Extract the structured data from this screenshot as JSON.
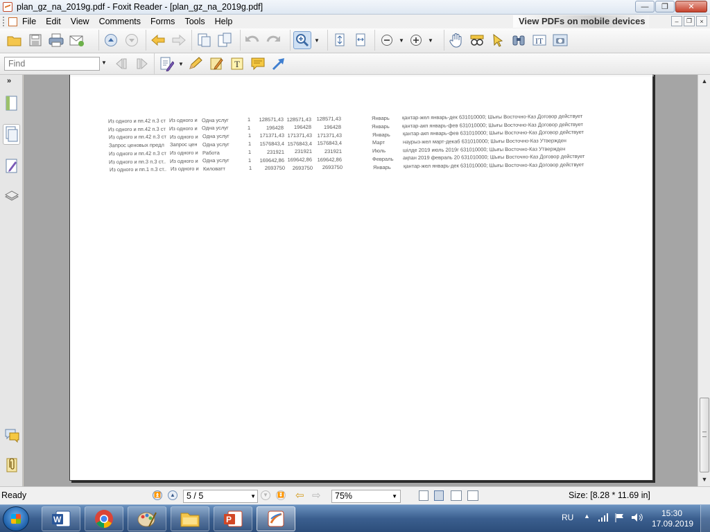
{
  "window": {
    "title": "plan_gz_na_2019g.pdf - Foxit Reader - [plan_gz_na_2019g.pdf]",
    "minimize_label": "—",
    "maximize_label": "❐",
    "close_label": "✕"
  },
  "menu": {
    "items": [
      "File",
      "Edit",
      "View",
      "Comments",
      "Forms",
      "Tools",
      "Help"
    ],
    "banner": "View PDFs on mobile devices",
    "mdi_min": "–",
    "mdi_restore": "❐",
    "mdi_close": "×"
  },
  "find": {
    "placeholder": "Find"
  },
  "document": {
    "rows": [
      {
        "a": "Из одного и пп.42 п.3 ст",
        "b": "Из одного и",
        "c": "Одна услуг",
        "q": "1",
        "v1": "128571,43",
        "v2": "128571,43",
        "v3": "128571,43",
        "month": "Январь",
        "text": "қантар-жел январь-дек 631010000; Шығы Восточно-Каз Договор действует"
      },
      {
        "a": "Из одного и пп.42 п.3 ст",
        "b": "Из одного и",
        "c": "Одна услуг",
        "q": "1",
        "v1": "196428",
        "v2": "196428",
        "v3": "196428",
        "month": "Январь",
        "text": "қантар-акп январь-фев 631010000; Шығы Восточно-Каз Договор действует"
      },
      {
        "a": "Из одного и пп.42 п.3 ст",
        "b": "Из одного и",
        "c": "Одна услуг",
        "q": "1",
        "v1": "171371,43",
        "v2": "171371,43",
        "v3": "171371,43",
        "month": "Январь",
        "text": "қантар-акп январь-фев 631010000; Шығы Восточно-Каз Договор действует"
      },
      {
        "a": "Запрос ценовых предл",
        "b": "Запрос цен",
        "c": "Одна услуг",
        "q": "1",
        "v1": "1576843,4",
        "v2": "1576843,4",
        "v3": "1576843,4",
        "month": "Март",
        "text": "наурыз-жел март-декаб 631010000; Шығы Восточно-Каз Утвержден"
      },
      {
        "a": "Из одного и пп.42 п.3 ст",
        "b": "Из одного и",
        "c": "Работа",
        "q": "1",
        "v1": "231921",
        "v2": "231921",
        "v3": "231921",
        "month": "Июль",
        "text": "шілде 2019 июль 2019г 631010000; Шығы Восточно-Каз Утвержден"
      },
      {
        "a": "Из одного и пп.3 п.3 ст..",
        "b": "Из одного и",
        "c": "Одна услуг",
        "q": "1",
        "v1": "169642,86",
        "v2": "169642,86",
        "v3": "169642,86",
        "month": "Февраль",
        "text": "ақпан 2019 февраль 20 631010000; Шығы Восточно-Каз Договор действует"
      },
      {
        "a": "Из одного и пп.1 п.3 ст..",
        "b": "Из одного и",
        "c": "Киловатт",
        "q": "1",
        "v1": "2693750",
        "v2": "2693750",
        "v3": "2693750",
        "month": "Январь",
        "text": "қантар-жел январь-дек 631010000; Шығы Восточно-Каз Договор действует"
      }
    ]
  },
  "status": {
    "ready": "Ready",
    "page": "5 / 5",
    "zoom": "75%",
    "size": "Size: [8.28 * 11.69 in]"
  },
  "taskbar": {
    "lang": "RU",
    "time": "15:30",
    "date": "17.09.2019"
  }
}
